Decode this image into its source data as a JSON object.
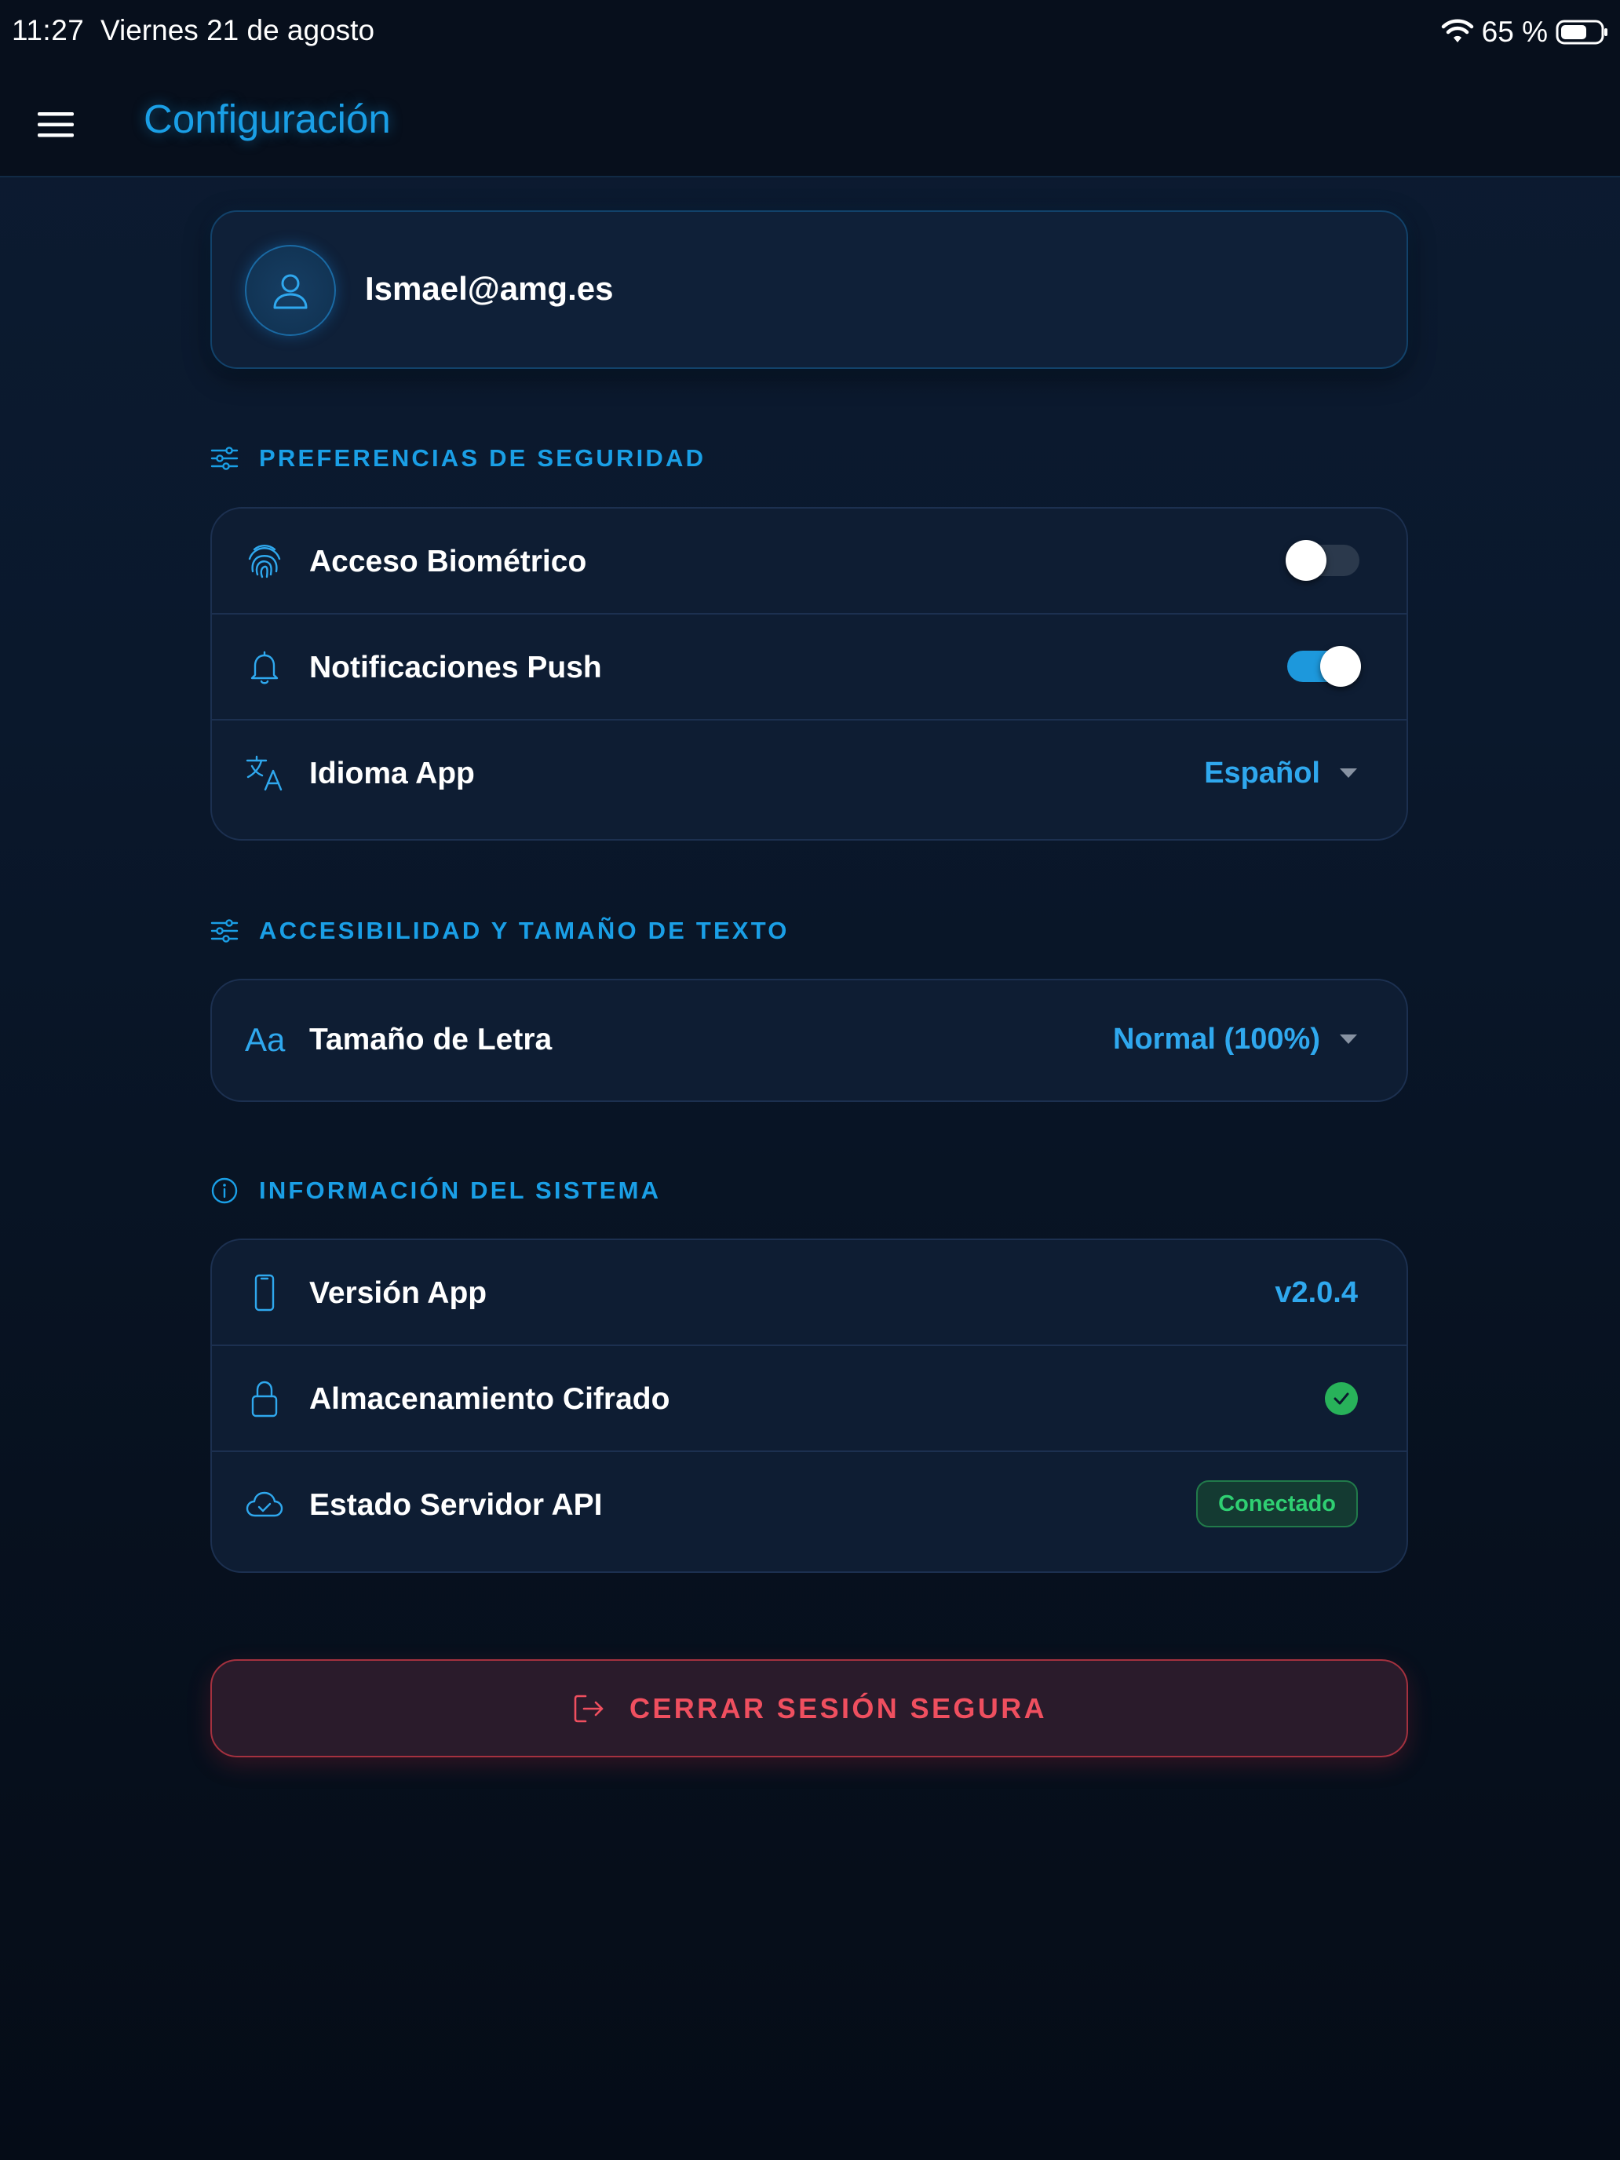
{
  "status_bar": {
    "time": "11:27",
    "date": "Viernes 21 de agosto",
    "battery": "65 %",
    "icons": [
      "wifi-icon",
      "battery-icon"
    ]
  },
  "header": {
    "title": "Configuración",
    "menu_icon": "hamburger-menu-icon"
  },
  "profile": {
    "email": "Ismael@amg.es",
    "icon": "user-icon"
  },
  "sections": {
    "security": {
      "title": "PREFERENCIAS DE SEGURIDAD",
      "icon": "sliders-icon",
      "rows": {
        "biometric": {
          "label": "Acceso Biométrico",
          "icon": "fingerprint-icon",
          "enabled": false
        },
        "push": {
          "label": "Notificaciones Push",
          "icon": "bell-icon",
          "enabled": true
        },
        "language": {
          "label": "Idioma App",
          "icon": "translate-icon",
          "value": "Español"
        }
      }
    },
    "accessibility": {
      "title": "ACCESIBILIDAD Y TAMAÑO DE TEXTO",
      "icon": "sliders-icon",
      "rows": {
        "font_size": {
          "label": "Tamaño de Letra",
          "icon": "font-size-icon",
          "icon_text": "Aa",
          "value": "Normal (100%)"
        }
      }
    },
    "system": {
      "title": "INFORMACIÓN DEL SISTEMA",
      "icon": "info-icon",
      "rows": {
        "version": {
          "label": "Versión App",
          "icon": "phone-icon",
          "value": "v2.0.4"
        },
        "storage": {
          "label": "Almacenamiento Cifrado",
          "icon": "lock-icon",
          "status_icon": "check-circle-icon"
        },
        "api": {
          "label": "Estado Servidor API",
          "icon": "cloud-check-icon",
          "status": "Conectado"
        }
      }
    }
  },
  "logout": {
    "label": "CERRAR SESIÓN SEGURA",
    "icon": "logout-icon"
  },
  "colors": {
    "accent": "#1a9fe6",
    "value": "#2fa8ee",
    "success": "#2fcf72",
    "danger": "#ef4f5f",
    "card_bg": "#0e1d33",
    "page_bg": "#0a182c"
  }
}
